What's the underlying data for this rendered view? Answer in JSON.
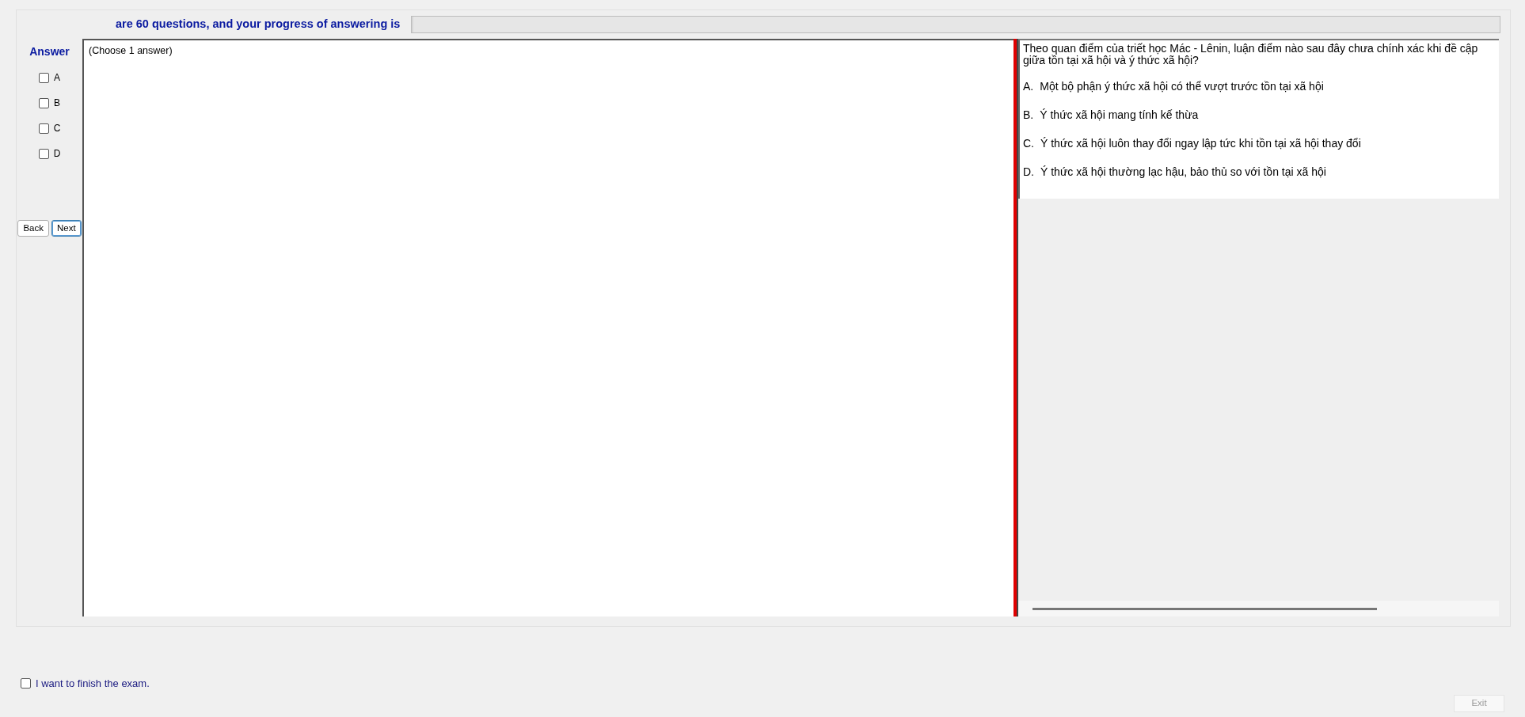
{
  "header": {
    "progress_label": "are 60 questions, and your progress of answering is",
    "progress": {
      "level": 0
    }
  },
  "answer_panel": {
    "title": "Answer",
    "options": [
      {
        "label": "A",
        "checked": false
      },
      {
        "label": "B",
        "checked": false
      },
      {
        "label": "C",
        "checked": false
      },
      {
        "label": "D",
        "checked": false
      }
    ],
    "buttons": [
      {
        "label": "Back",
        "focused": false
      },
      {
        "label": "Next",
        "focused": true
      }
    ]
  },
  "work_area": {
    "instruction": "(Choose 1 answer)"
  },
  "question": {
    "text": "Theo quan điểm của triết học Mác - Lênin, luận điểm nào sau đây chưa chính xác khi đề cập giữa tồn tại xã hội và ý thức xã hội?",
    "choices": [
      {
        "letter": "A.",
        "text": "Một bộ phận ý thức xã hội có thể vượt trước tồn tại xã hội"
      },
      {
        "letter": "B.",
        "text": "Ý thức xã hội mang tính kế thừa"
      },
      {
        "letter": "C.",
        "text": "Ý thức xã hội luôn thay đổi ngay lập tức khi tồn tại xã hội thay đổi"
      },
      {
        "letter": "D.",
        "text": "Ý thức xã hội thường lạc hậu, bảo thủ so với tồn tại xã hội"
      }
    ]
  },
  "footer": {
    "finish": {
      "label": "I want to finish the exam.",
      "checked": false
    },
    "exit": {
      "label": "Exit",
      "disabled": true
    }
  }
}
